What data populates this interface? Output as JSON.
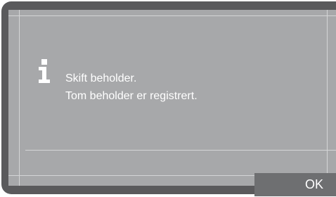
{
  "dialog": {
    "icon": "info-icon",
    "message_line_1": "Skift beholder.",
    "message_line_2": "Tom beholder er registrert."
  },
  "actions": {
    "ok_label": "OK"
  },
  "colors": {
    "bezel": "#5a5a5c",
    "screen": "#a7a8aa",
    "text": "#ffffff",
    "button_bg": "#6e6f71"
  }
}
